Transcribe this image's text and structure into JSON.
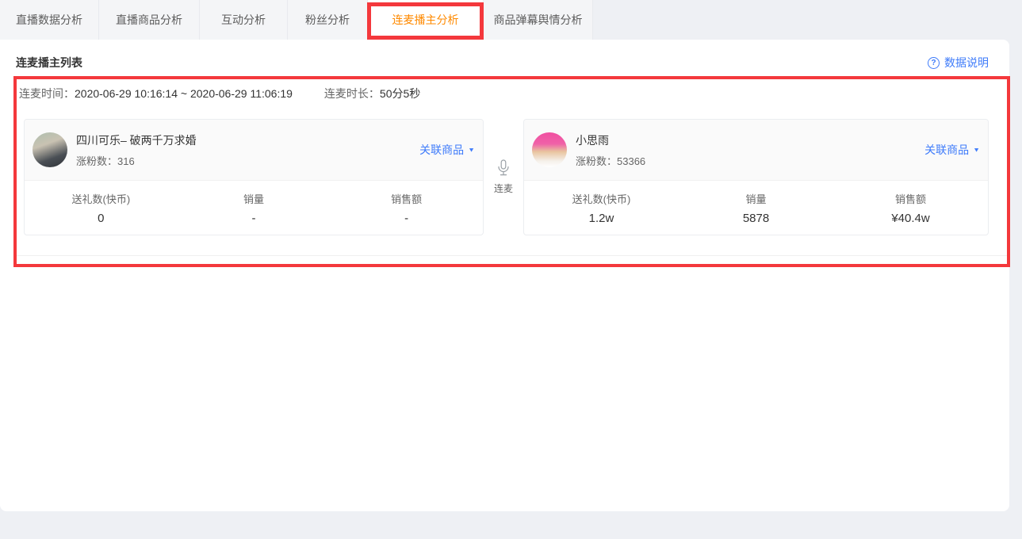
{
  "colors": {
    "accent_orange": "#ff8a00",
    "link_blue": "#3e7bfa",
    "annotation_red": "#f4383c",
    "page_bg": "#eef0f4"
  },
  "glyphs": {
    "help": "?",
    "caret_down": "▼"
  },
  "tabs": [
    {
      "label": "直播数据分析",
      "active": false
    },
    {
      "label": "直播商品分析",
      "active": false
    },
    {
      "label": "互动分析",
      "active": false
    },
    {
      "label": "粉丝分析",
      "active": false
    },
    {
      "label": "连麦播主分析",
      "active": true
    },
    {
      "label": "商品弹幕舆情分析",
      "active": false
    }
  ],
  "header": {
    "title": "连麦播主列表",
    "help_label": "数据说明"
  },
  "session": {
    "time_label": "连麦时间：",
    "time_value": "2020-06-29 10:16:14 ~ 2020-06-29 11:06:19",
    "duration_label": "连麦时长：",
    "duration_value": "50分5秒",
    "mic_label": "连麦",
    "link_label": "关联商品",
    "hosts": [
      {
        "name": "四川可乐– 破两千万求婚",
        "fans_label": "涨粉数：",
        "fans_value": "316",
        "stats": [
          {
            "label": "送礼数(快币)",
            "value": "0"
          },
          {
            "label": "销量",
            "value": "-"
          },
          {
            "label": "销售额",
            "value": "-"
          }
        ]
      },
      {
        "name": "小思雨",
        "fans_label": "涨粉数：",
        "fans_value": "53366",
        "stats": [
          {
            "label": "送礼数(快币)",
            "value": "1.2w"
          },
          {
            "label": "销量",
            "value": "5878"
          },
          {
            "label": "销售额",
            "value": "¥40.4w"
          }
        ]
      }
    ]
  }
}
